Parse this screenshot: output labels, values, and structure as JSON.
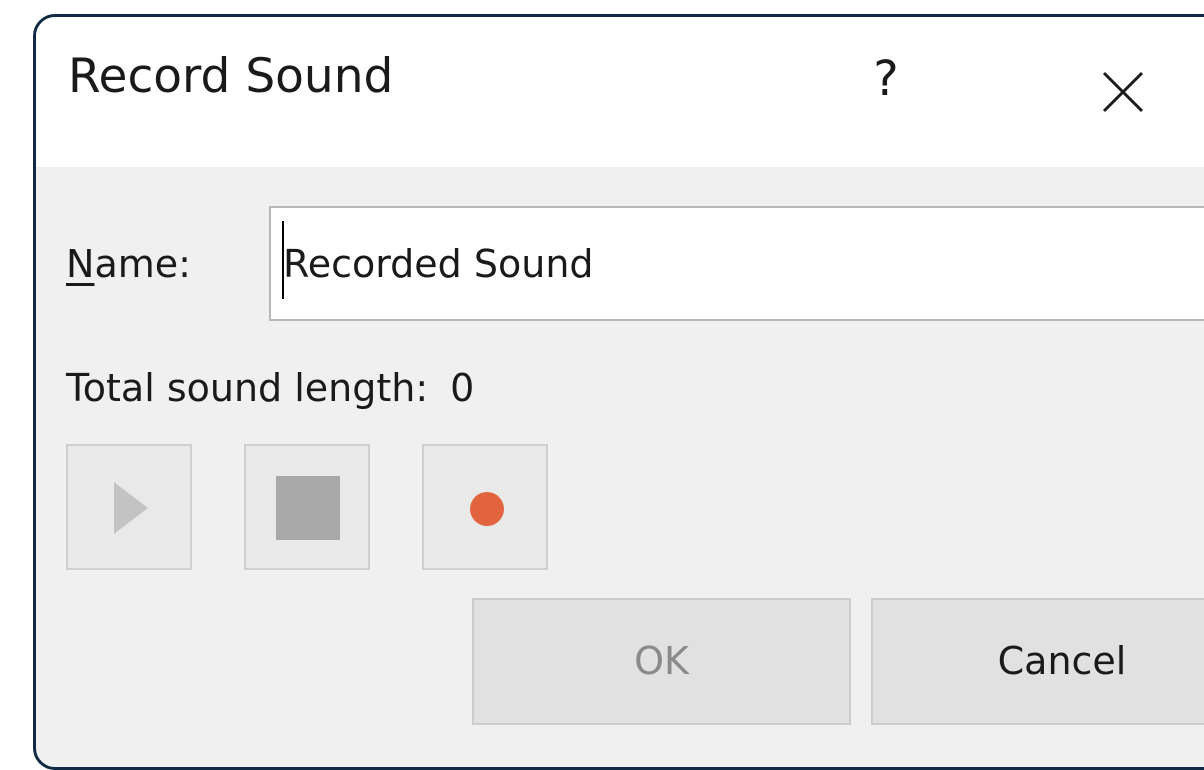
{
  "dialog": {
    "title": "Record Sound",
    "help_label": "?",
    "close_icon": "close-icon"
  },
  "name": {
    "mnemonic": "N",
    "label_rest": "ame:",
    "value": "Recorded Sound"
  },
  "sound_length": {
    "label": "Total sound length:",
    "value": "0"
  },
  "controls": {
    "play": {
      "icon": "play-icon",
      "enabled": false
    },
    "stop": {
      "icon": "stop-icon",
      "enabled": false
    },
    "record": {
      "icon": "record-icon",
      "enabled": true,
      "color": "#e2643f"
    }
  },
  "buttons": {
    "ok_label": "OK",
    "ok_enabled": false,
    "cancel_label": "Cancel"
  },
  "colors": {
    "disabled_icon": "#c3c3c3",
    "stop_icon": "#a9a9a9",
    "border": "#0f2a44"
  }
}
